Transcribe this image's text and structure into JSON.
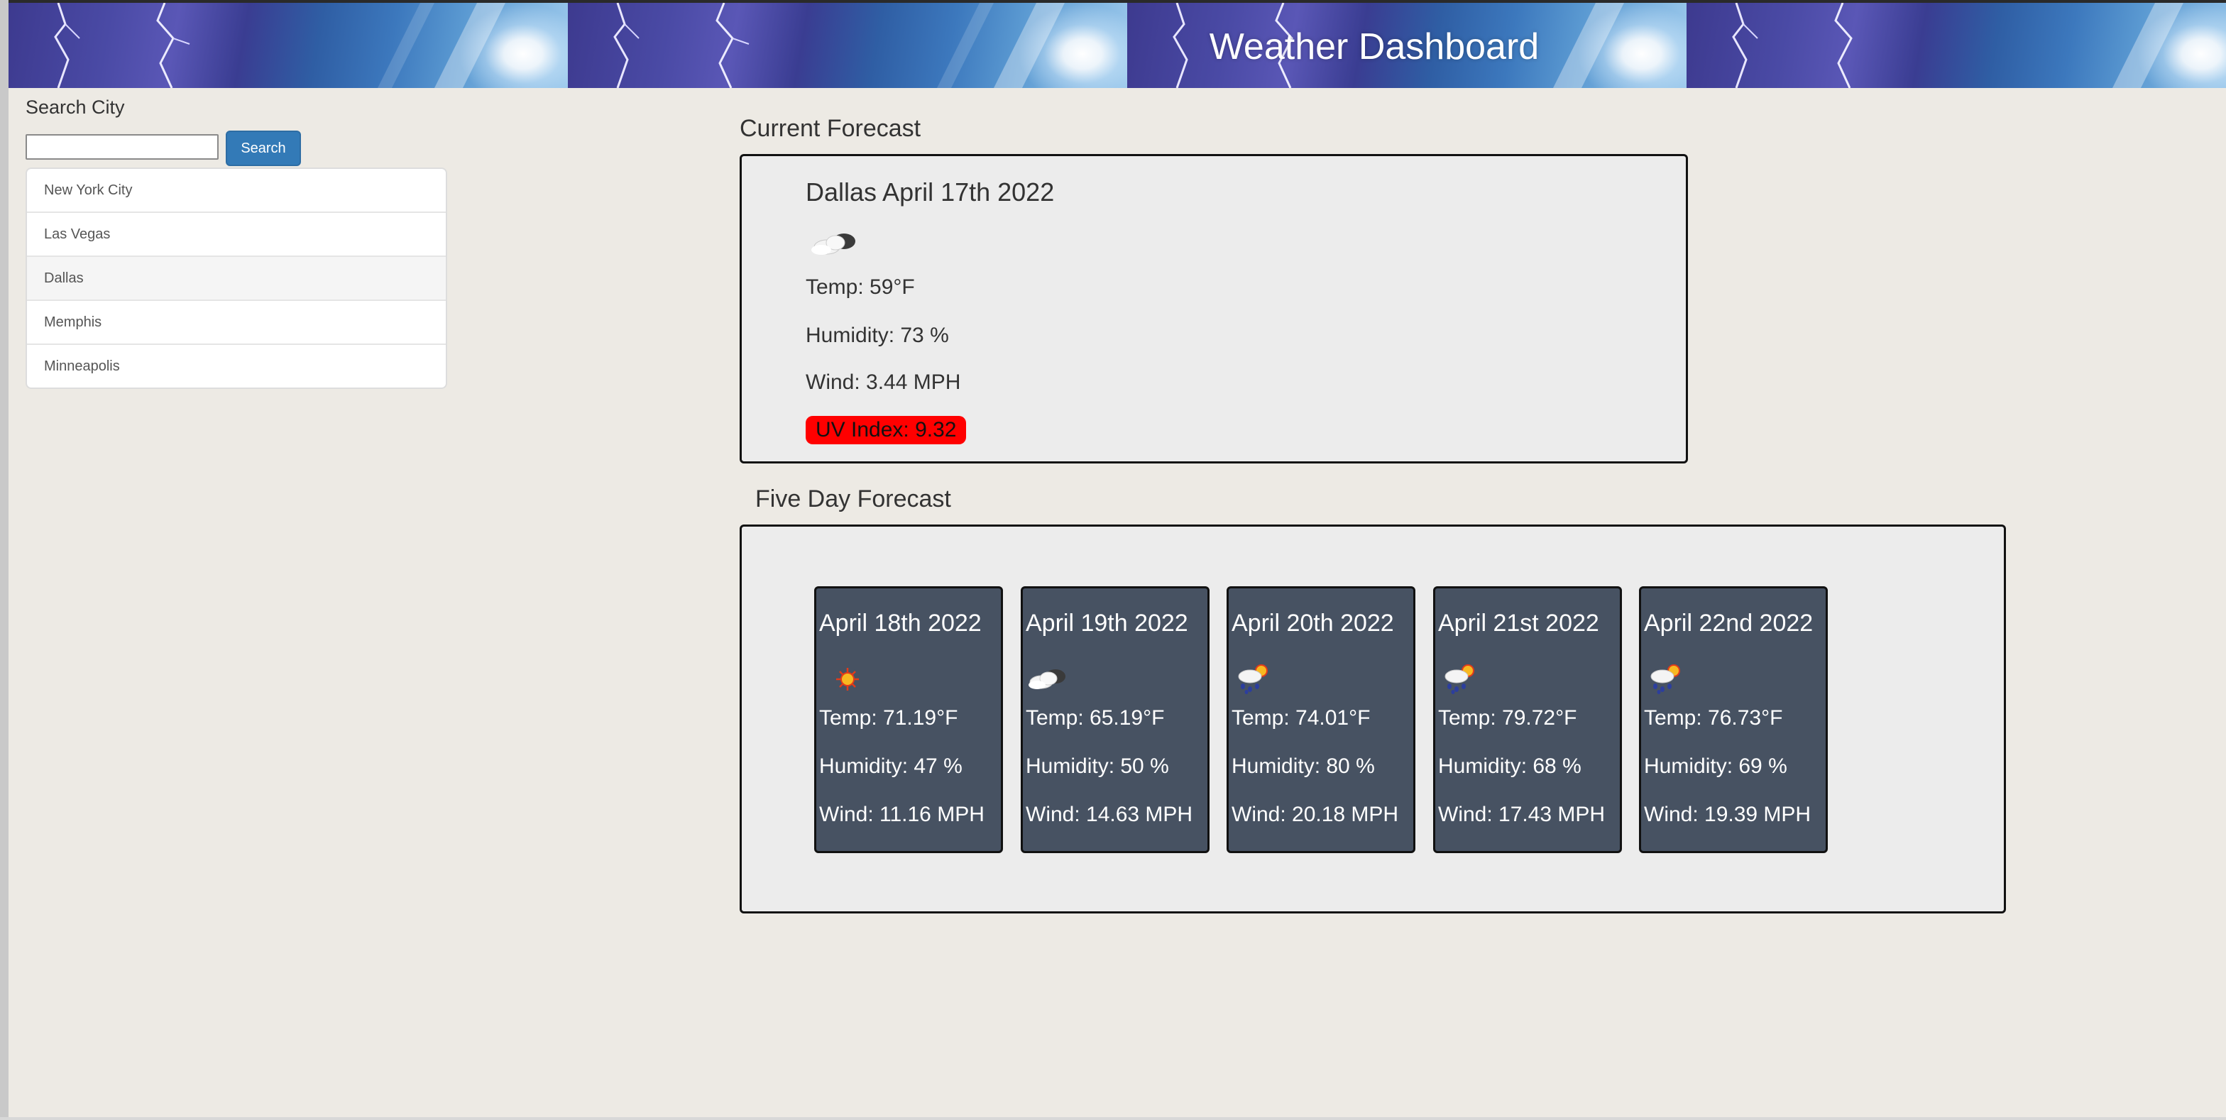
{
  "header": {
    "title": "Weather Dashboard"
  },
  "sidebar": {
    "search_label": "Search City",
    "search_input": {
      "value": "",
      "placeholder": ""
    },
    "search_button": "Search",
    "cities": [
      {
        "label": "New York City",
        "active": false
      },
      {
        "label": "Las Vegas",
        "active": false
      },
      {
        "label": "Dallas",
        "active": true
      },
      {
        "label": "Memphis",
        "active": false
      },
      {
        "label": "Minneapolis",
        "active": false
      }
    ]
  },
  "current": {
    "section_title": "Current Forecast",
    "title": "Dallas April 17th 2022",
    "icon": "cloud-partly-cloudy-icon",
    "temp": "Temp: 59°F",
    "humidity": "Humidity: 73 %",
    "wind": "Wind: 3.44 MPH",
    "uv": "UV Index: 9.32",
    "uv_color": "#ff0000"
  },
  "five_day": {
    "section_title": "Five Day Forecast",
    "days": [
      {
        "date": "April 18th 2022",
        "icon": "sun-icon",
        "temp": "Temp: 71.19°F",
        "humidity": "Humidity: 47 %",
        "wind": "Wind: 11.16 MPH"
      },
      {
        "date": "April 19th 2022",
        "icon": "cloud-partly-cloudy-icon",
        "temp": "Temp: 65.19°F",
        "humidity": "Humidity: 50 %",
        "wind": "Wind: 14.63 MPH"
      },
      {
        "date": "April 20th 2022",
        "icon": "rain-sun-icon",
        "temp": "Temp: 74.01°F",
        "humidity": "Humidity: 80 %",
        "wind": "Wind: 20.18 MPH"
      },
      {
        "date": "April 21st 2022",
        "icon": "rain-sun-icon",
        "temp": "Temp: 79.72°F",
        "humidity": "Humidity: 68 %",
        "wind": "Wind: 17.43 MPH"
      },
      {
        "date": "April 22nd 2022",
        "icon": "rain-sun-icon",
        "temp": "Temp: 76.73°F",
        "humidity": "Humidity: 69 %",
        "wind": "Wind: 19.39 MPH"
      }
    ]
  },
  "colors": {
    "page_bg": "#edeae4",
    "card_bg": "#475262",
    "button_bg": "#337ab7",
    "uv_badge": "#ff0000"
  }
}
